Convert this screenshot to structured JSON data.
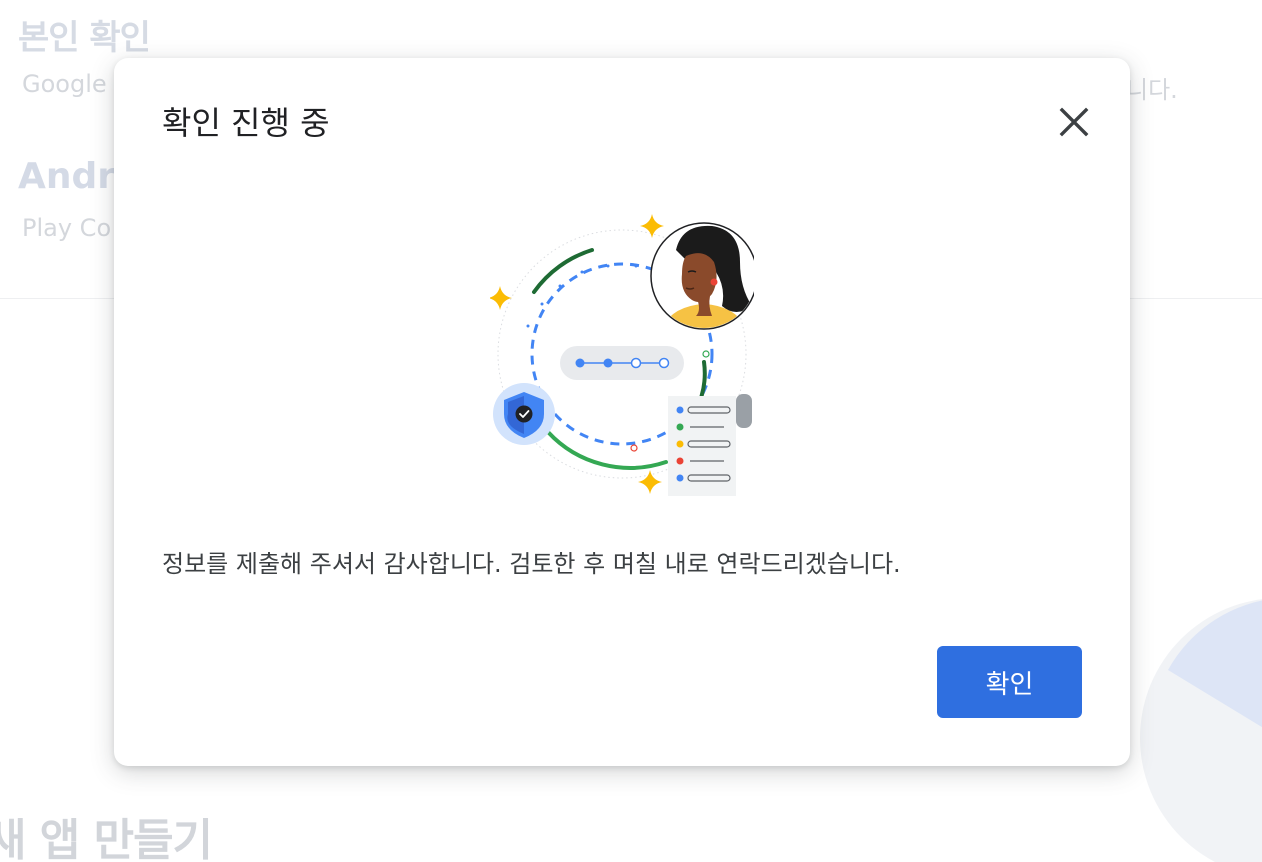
{
  "background": {
    "section1": {
      "title": "본인 확인",
      "description_start": "Google",
      "description_end": "니다."
    },
    "section2": {
      "title": "Andro",
      "description": "Play Co"
    },
    "bottom_title": "새 앱 만들기"
  },
  "dialog": {
    "title": "확인 진행 중",
    "close_icon": "close-icon",
    "message": "정보를 제출해 주셔서 감사합니다. 검토한 후 며칠 내로 연락드리겠습니다.",
    "confirm_label": "확인"
  },
  "colors": {
    "primary_button": "#2f6fe0",
    "google_blue": "#4285f4",
    "google_green": "#34a853",
    "google_yellow": "#fbbc04",
    "google_red": "#ea4335"
  }
}
